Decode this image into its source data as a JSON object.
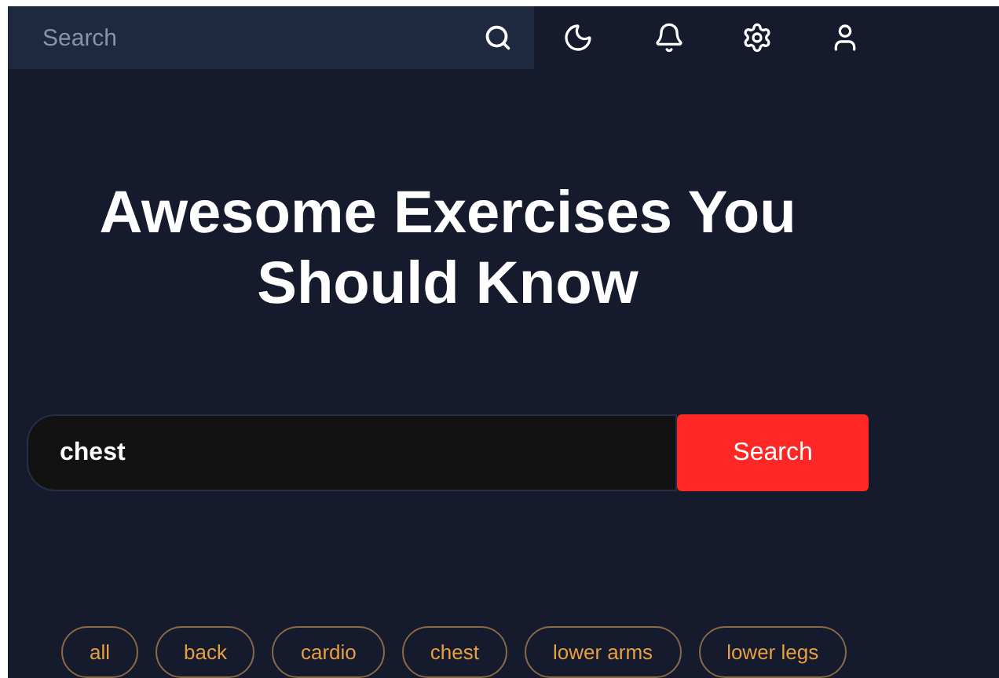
{
  "topbar": {
    "search": {
      "placeholder": "Search"
    }
  },
  "hero": {
    "title": "Awesome Exercises You Should Know"
  },
  "search_form": {
    "value": "chest",
    "button": "Search"
  },
  "categories": [
    "all",
    "back",
    "cardio",
    "chest",
    "lower arms",
    "lower legs"
  ]
}
